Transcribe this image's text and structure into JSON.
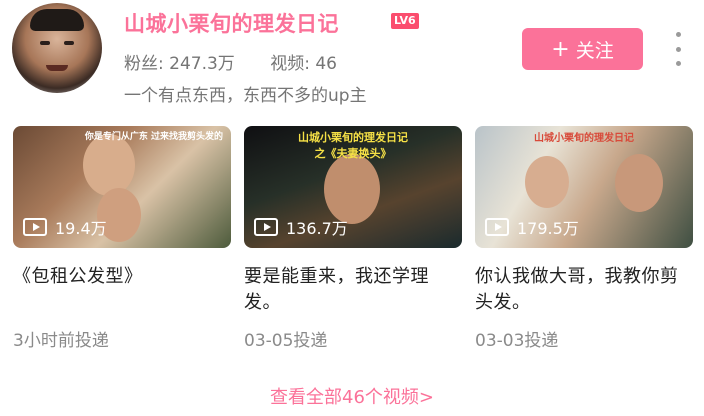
{
  "profile": {
    "name": "山城小栗旬的理发日记",
    "level": "LV6",
    "fans_label": "粉丝: 247.3万",
    "videos_label": "视频: 46",
    "bio": "一个有点东西，东西不多的up主"
  },
  "actions": {
    "follow_label": "关注",
    "follow_plus": "+"
  },
  "videos": [
    {
      "views": "19.4万",
      "title": "《包租公发型》",
      "date": "3小时前投递",
      "overlay": "你是专门从广东\n过来找我剪头发的"
    },
    {
      "views": "136.7万",
      "title": "要是能重来，我还学理发。",
      "date": "03-05投递",
      "overlay": "山城小栗旬的理发日记\n之《夫妻换头》"
    },
    {
      "views": "179.5万",
      "title": "你认我做大哥，我教你剪头发。",
      "date": "03-03投递",
      "overlay": "山城小栗旬的理发日记"
    }
  ],
  "footer": {
    "view_all": "查看全部46个视频>"
  },
  "colors": {
    "accent": "#fb7299",
    "muted": "#757575"
  },
  "icons": {
    "play": "play-icon",
    "more": "more-vertical-icon"
  }
}
